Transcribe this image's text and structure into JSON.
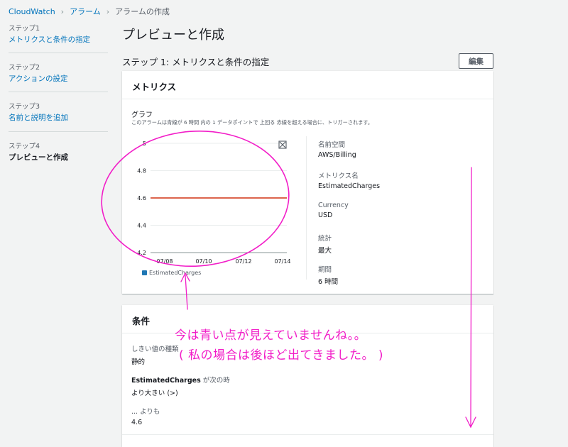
{
  "breadcrumb": {
    "items": [
      "CloudWatch",
      "アラーム",
      "アラームの作成"
    ]
  },
  "sidebar": {
    "steps": [
      {
        "num": "ステップ1",
        "title": "メトリクスと条件の指定"
      },
      {
        "num": "ステップ2",
        "title": "アクションの設定"
      },
      {
        "num": "ステップ3",
        "title": "名前と説明を追加"
      },
      {
        "num": "ステップ4",
        "title": "プレビューと作成"
      }
    ]
  },
  "page": {
    "title": "プレビューと作成",
    "section_title": "ステップ 1: メトリクスと条件の指定",
    "edit_label": "編集"
  },
  "metrics": {
    "header": "メトリクス",
    "graph_title": "グラフ",
    "graph_desc": "このアラームは青線が 6 時間 内の 1 データポイントで 上回る 赤線を超える場合に、トリガーされます。",
    "legend": "EstimatedCharges",
    "meta": [
      {
        "label": "名前空間",
        "value": "AWS/Billing"
      },
      {
        "label": "メトリクス名",
        "value": "EstimatedCharges"
      },
      {
        "label": "Currency",
        "value": "USD"
      },
      {
        "label": "統計",
        "value": "最大"
      },
      {
        "label": "期間",
        "value": "6 時間"
      }
    ]
  },
  "chart_data": {
    "type": "line",
    "title": "",
    "xlabel": "",
    "ylabel": "",
    "x_ticks": [
      "07/08",
      "07/10",
      "07/12",
      "07/14"
    ],
    "y_ticks": [
      "5",
      "4.8",
      "4.6",
      "4.4",
      "4.2"
    ],
    "ylim": [
      4.2,
      5
    ],
    "threshold": 4.6,
    "series": [
      {
        "name": "EstimatedCharges",
        "values": []
      }
    ],
    "colors": {
      "threshold": "#d13212",
      "series": "#1f77b4",
      "grid": "#eaeded",
      "axis": "#879596"
    }
  },
  "conditions": {
    "header": "条件",
    "threshold_type_label": "しきい値の種類",
    "threshold_type_value": "静的",
    "when_metric": "EstimatedCharges",
    "when_suffix": "が次の時",
    "when_value": "より大きい (>)",
    "than_label": "... よりも",
    "than_value": "4.6"
  },
  "annotations": {
    "line1": "今は青い点が見えていませんね。。",
    "line2": "( 私の場合は後ほど出てきました。 )",
    "color": "#f21ec8"
  }
}
